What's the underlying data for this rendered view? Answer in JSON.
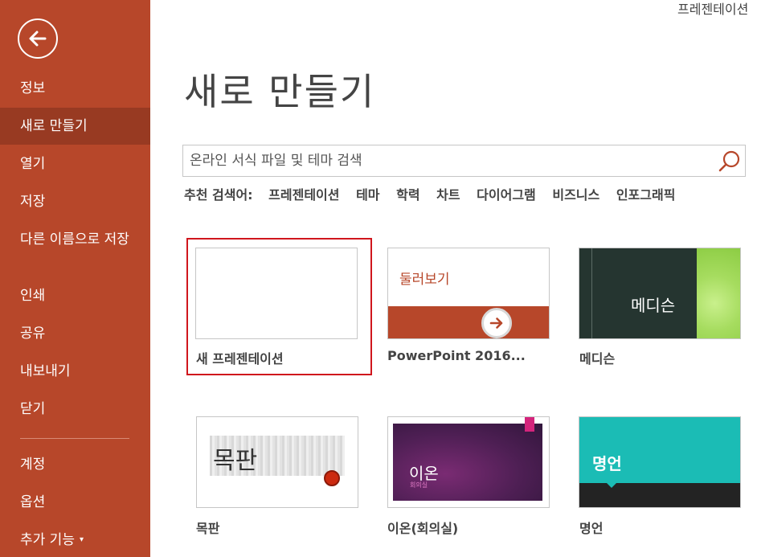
{
  "window": {
    "title": "프레젠테이션"
  },
  "sidebar": {
    "items": [
      {
        "label": "정보"
      },
      {
        "label": "새로 만들기"
      },
      {
        "label": "열기"
      },
      {
        "label": "저장"
      },
      {
        "label": "다른 이름으로 저장"
      },
      {
        "label": "인쇄"
      },
      {
        "label": "공유"
      },
      {
        "label": "내보내기"
      },
      {
        "label": "닫기"
      },
      {
        "label": "계정"
      },
      {
        "label": "옵션"
      },
      {
        "label": "추가 기능"
      }
    ],
    "active_index": 1,
    "accent_color": "#b7472a",
    "active_color": "#983a22"
  },
  "main": {
    "title": "새로 만들기",
    "search": {
      "placeholder": "온라인 서식 파일 및 테마 검색"
    },
    "suggested": {
      "label": "추천 검색어:",
      "items": [
        "프레젠테이션",
        "테마",
        "학력",
        "차트",
        "다이어그램",
        "비즈니스",
        "인포그래픽"
      ]
    },
    "templates": [
      {
        "name": "새 프레젠테이션",
        "selected": true
      },
      {
        "name": "PowerPoint 2016...",
        "thumb_text": "둘러보기"
      },
      {
        "name": "메디슨",
        "thumb_text": "메디슨"
      },
      {
        "name": "목판",
        "thumb_text": "목판"
      },
      {
        "name": "이온(회의실)",
        "thumb_text": "이온",
        "thumb_sub": "회의실"
      },
      {
        "name": "명언",
        "thumb_text": "명언"
      }
    ],
    "selection_color": "#d0161d"
  }
}
